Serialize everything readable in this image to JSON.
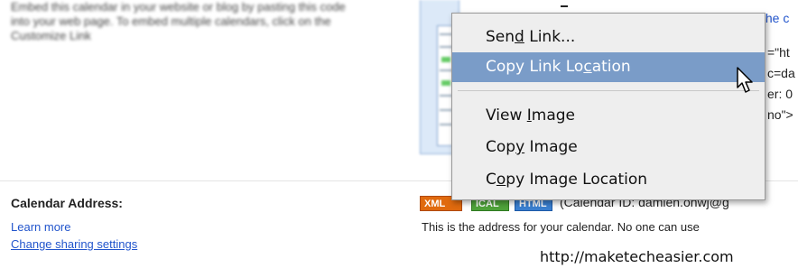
{
  "embed_section": {
    "description": "Embed this calendar in your website or blog by pasting this code into your web page. To embed multiple calendars, click on the Customize Link"
  },
  "code_fragments": {
    "link_frag": "the c",
    "line1": "=\"ht",
    "line2": "c=da",
    "line3": "er: 0",
    "line4": "no\">"
  },
  "calendar_address": {
    "label": "Calendar Address:",
    "learn_more": "Learn more",
    "change_sharing": "Change sharing settings",
    "badges": {
      "xml": "XML",
      "ical": "ICAL",
      "html": "HTML"
    },
    "calendar_id": "(Calendar ID: damien.ohwj@g",
    "description": "This is the address for your calendar. No one can use"
  },
  "context_menu": {
    "items": [
      {
        "before": "Sen",
        "accel": "d",
        "after": " Link..."
      },
      {
        "before": "Copy Link Lo",
        "accel": "c",
        "after": "ation"
      },
      {
        "before": "View ",
        "accel": "I",
        "after": "mage"
      },
      {
        "before": "Cop",
        "accel": "y",
        "after": " Image"
      },
      {
        "before": "C",
        "accel": "o",
        "after": "py Image Location"
      }
    ],
    "highlight_color": "#7a9cc8"
  },
  "watermark": "http://maketecheasier.com"
}
